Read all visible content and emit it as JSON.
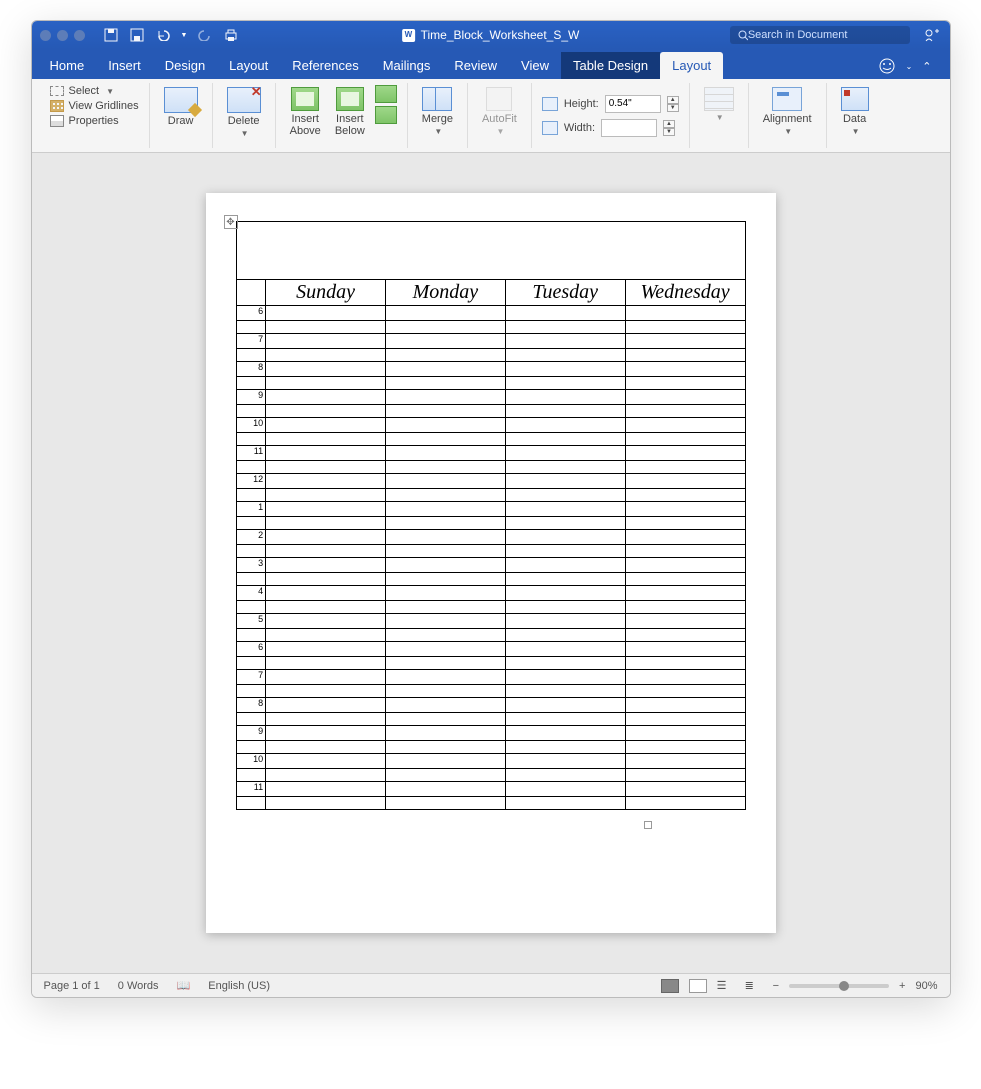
{
  "titlebar": {
    "document_name": "Time_Block_Worksheet_S_W",
    "search_placeholder": "Search in Document"
  },
  "tabs": {
    "items": [
      "Home",
      "Insert",
      "Design",
      "Layout",
      "References",
      "Mailings",
      "Review",
      "View"
    ],
    "context": [
      "Table Design",
      "Layout"
    ],
    "active": "Layout"
  },
  "ribbon": {
    "select": {
      "select": "Select",
      "gridlines": "View Gridlines",
      "properties": "Properties"
    },
    "draw": "Draw",
    "delete": "Delete",
    "insert_above": "Insert\nAbove",
    "insert_below": "Insert\nBelow",
    "merge": "Merge",
    "autofit": "AutoFit",
    "height_label": "Height:",
    "height_value": "0.54\"",
    "width_label": "Width:",
    "width_value": "",
    "alignment": "Alignment",
    "data": "Data"
  },
  "worksheet": {
    "days": [
      "Sunday",
      "Monday",
      "Tuesday",
      "Wednesday"
    ],
    "hours": [
      "6",
      "7",
      "8",
      "9",
      "10",
      "11",
      "12",
      "1",
      "2",
      "3",
      "4",
      "5",
      "6",
      "7",
      "8",
      "9",
      "10",
      "11"
    ]
  },
  "statusbar": {
    "page": "Page 1 of 1",
    "words": "0 Words",
    "language": "English (US)",
    "zoom": "90%"
  }
}
